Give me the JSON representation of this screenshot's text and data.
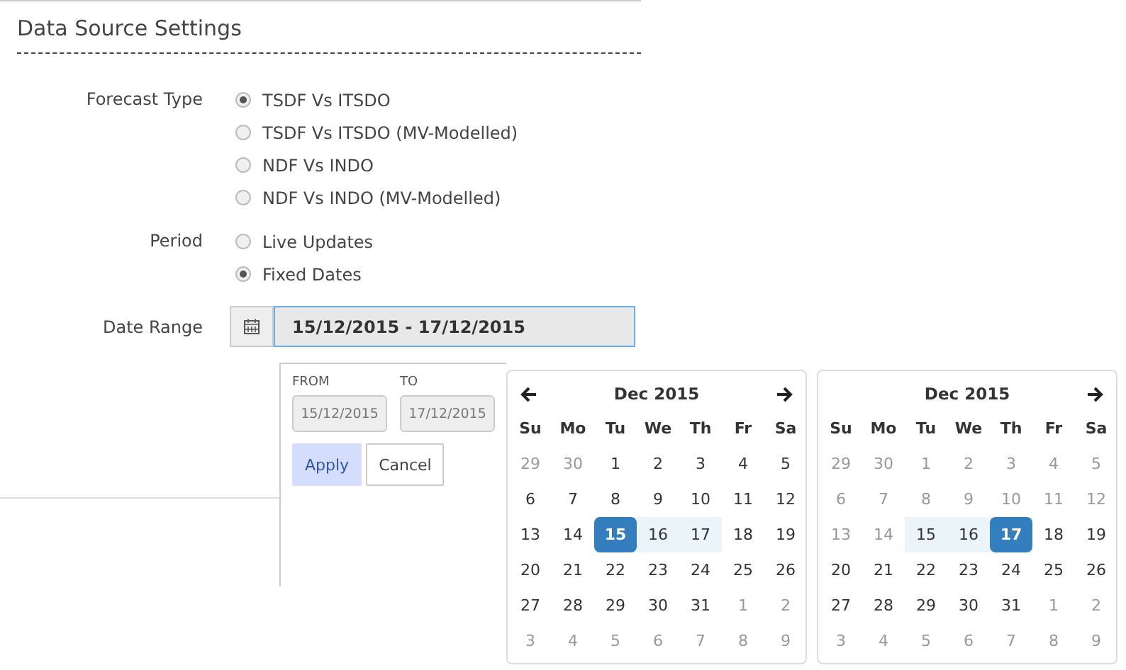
{
  "section_title": "Data Source Settings",
  "fields": [
    {
      "label": "Forecast Type",
      "kind": "radio",
      "options": [
        {
          "label": "TSDF Vs ITSDO",
          "selected": true
        },
        {
          "label": "TSDF Vs ITSDO (MV-Modelled)",
          "selected": false
        },
        {
          "label": "NDF Vs INDO",
          "selected": false
        },
        {
          "label": "NDF Vs INDO (MV-Modelled)",
          "selected": false
        }
      ]
    },
    {
      "label": "Period",
      "kind": "radio",
      "options": [
        {
          "label": "Live Updates",
          "selected": false
        },
        {
          "label": "Fixed Dates",
          "selected": true
        }
      ]
    },
    {
      "label": "Date Range",
      "kind": "daterange",
      "value": "15/12/2015 - 17/12/2015",
      "focused": true
    }
  ],
  "picker": {
    "from_label": "FROM",
    "from_value": "15/12/2015",
    "to_label": "TO",
    "to_value": "17/12/2015",
    "buttons": [
      {
        "label": "Apply",
        "primary": true
      },
      {
        "label": "Cancel",
        "primary": false
      }
    ],
    "calendars": [
      {
        "title": "Dec 2015",
        "prev": true,
        "next": true,
        "weekdays": [
          "Su",
          "Mo",
          "Tu",
          "We",
          "Th",
          "Fr",
          "Sa"
        ],
        "weeks": [
          [
            {
              "d": "29",
              "kind": "off"
            },
            {
              "d": "30",
              "kind": "off"
            },
            {
              "d": "1",
              "kind": "day"
            },
            {
              "d": "2",
              "kind": "day"
            },
            {
              "d": "3",
              "kind": "day"
            },
            {
              "d": "4",
              "kind": "day"
            },
            {
              "d": "5",
              "kind": "day"
            }
          ],
          [
            {
              "d": "6",
              "kind": "day"
            },
            {
              "d": "7",
              "kind": "day"
            },
            {
              "d": "8",
              "kind": "day"
            },
            {
              "d": "9",
              "kind": "day"
            },
            {
              "d": "10",
              "kind": "day"
            },
            {
              "d": "11",
              "kind": "day"
            },
            {
              "d": "12",
              "kind": "day"
            }
          ],
          [
            {
              "d": "13",
              "kind": "day"
            },
            {
              "d": "14",
              "kind": "day"
            },
            {
              "d": "15",
              "kind": "active"
            },
            {
              "d": "16",
              "kind": "range"
            },
            {
              "d": "17",
              "kind": "range"
            },
            {
              "d": "18",
              "kind": "day"
            },
            {
              "d": "19",
              "kind": "day"
            }
          ],
          [
            {
              "d": "20",
              "kind": "day"
            },
            {
              "d": "21",
              "kind": "day"
            },
            {
              "d": "22",
              "kind": "day"
            },
            {
              "d": "23",
              "kind": "day"
            },
            {
              "d": "24",
              "kind": "day"
            },
            {
              "d": "25",
              "kind": "day"
            },
            {
              "d": "26",
              "kind": "day"
            }
          ],
          [
            {
              "d": "27",
              "kind": "day"
            },
            {
              "d": "28",
              "kind": "day"
            },
            {
              "d": "29",
              "kind": "day"
            },
            {
              "d": "30",
              "kind": "day"
            },
            {
              "d": "31",
              "kind": "day"
            },
            {
              "d": "1",
              "kind": "off"
            },
            {
              "d": "2",
              "kind": "off"
            }
          ],
          [
            {
              "d": "3",
              "kind": "off"
            },
            {
              "d": "4",
              "kind": "off"
            },
            {
              "d": "5",
              "kind": "off"
            },
            {
              "d": "6",
              "kind": "off"
            },
            {
              "d": "7",
              "kind": "off"
            },
            {
              "d": "8",
              "kind": "off"
            },
            {
              "d": "9",
              "kind": "off"
            }
          ]
        ]
      },
      {
        "title": "Dec 2015",
        "prev": false,
        "next": true,
        "weekdays": [
          "Su",
          "Mo",
          "Tu",
          "We",
          "Th",
          "Fr",
          "Sa"
        ],
        "weeks": [
          [
            {
              "d": "29",
              "kind": "off"
            },
            {
              "d": "30",
              "kind": "off"
            },
            {
              "d": "1",
              "kind": "off"
            },
            {
              "d": "2",
              "kind": "off"
            },
            {
              "d": "3",
              "kind": "off"
            },
            {
              "d": "4",
              "kind": "off"
            },
            {
              "d": "5",
              "kind": "off"
            }
          ],
          [
            {
              "d": "6",
              "kind": "off"
            },
            {
              "d": "7",
              "kind": "off"
            },
            {
              "d": "8",
              "kind": "off"
            },
            {
              "d": "9",
              "kind": "off"
            },
            {
              "d": "10",
              "kind": "off"
            },
            {
              "d": "11",
              "kind": "off"
            },
            {
              "d": "12",
              "kind": "off"
            }
          ],
          [
            {
              "d": "13",
              "kind": "off"
            },
            {
              "d": "14",
              "kind": "off"
            },
            {
              "d": "15",
              "kind": "range"
            },
            {
              "d": "16",
              "kind": "range"
            },
            {
              "d": "17",
              "kind": "active"
            },
            {
              "d": "18",
              "kind": "day"
            },
            {
              "d": "19",
              "kind": "day"
            }
          ],
          [
            {
              "d": "20",
              "kind": "day"
            },
            {
              "d": "21",
              "kind": "day"
            },
            {
              "d": "22",
              "kind": "day"
            },
            {
              "d": "23",
              "kind": "day"
            },
            {
              "d": "24",
              "kind": "day"
            },
            {
              "d": "25",
              "kind": "day"
            },
            {
              "d": "26",
              "kind": "day"
            }
          ],
          [
            {
              "d": "27",
              "kind": "day"
            },
            {
              "d": "28",
              "kind": "day"
            },
            {
              "d": "29",
              "kind": "day"
            },
            {
              "d": "30",
              "kind": "day"
            },
            {
              "d": "31",
              "kind": "day"
            },
            {
              "d": "1",
              "kind": "off"
            },
            {
              "d": "2",
              "kind": "off"
            }
          ],
          [
            {
              "d": "3",
              "kind": "off"
            },
            {
              "d": "4",
              "kind": "off"
            },
            {
              "d": "5",
              "kind": "off"
            },
            {
              "d": "6",
              "kind": "off"
            },
            {
              "d": "7",
              "kind": "off"
            },
            {
              "d": "8",
              "kind": "off"
            },
            {
              "d": "9",
              "kind": "off"
            }
          ]
        ]
      }
    ]
  }
}
